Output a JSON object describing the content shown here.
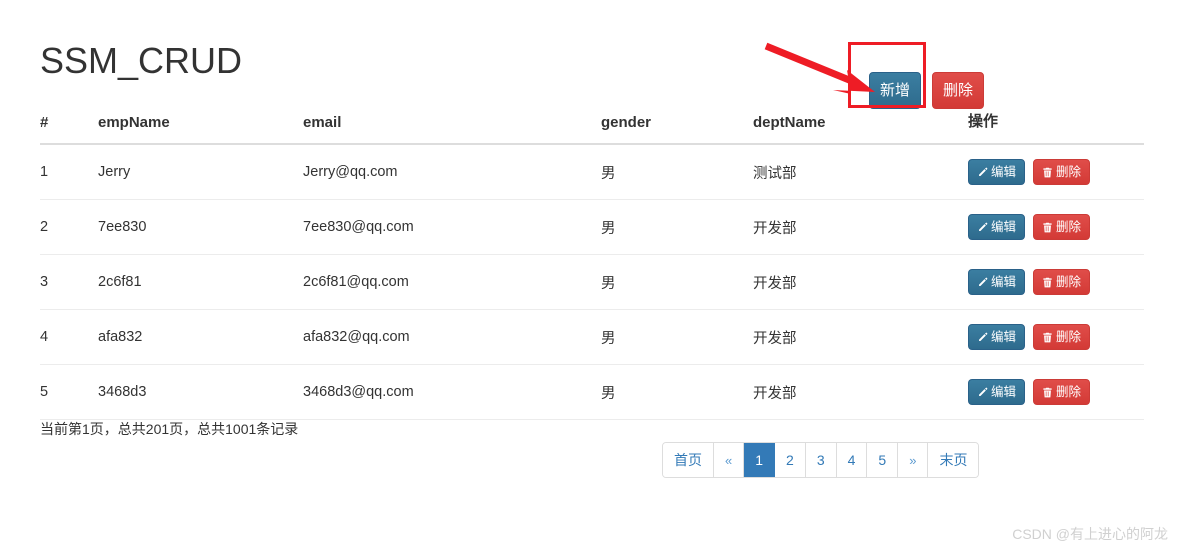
{
  "page": {
    "title": "SSM_CRUD"
  },
  "toolbar": {
    "add_label": "新增",
    "delete_label": "删除",
    "add_icon": "none",
    "delete_icon": "none",
    "primary_color": "#31708f",
    "danger_color": "#d9534f"
  },
  "annotation": {
    "rect_color": "#ee1c25",
    "arrow_color": "#ee1c25",
    "arrow_target": "新增"
  },
  "table": {
    "columns": [
      {
        "key": "idx",
        "label": "#"
      },
      {
        "key": "empName",
        "label": "empName"
      },
      {
        "key": "email",
        "label": "email"
      },
      {
        "key": "gender",
        "label": "gender"
      },
      {
        "key": "deptName",
        "label": "deptName"
      },
      {
        "key": "ops",
        "label": "操作"
      }
    ],
    "row_actions": {
      "edit_label": "编辑",
      "edit_icon": "pencil-icon",
      "delete_label": "删除",
      "delete_icon": "trash-icon"
    },
    "rows": [
      {
        "idx": "1",
        "empName": "Jerry",
        "email": "Jerry@qq.com",
        "gender": "男",
        "deptName": "测试部"
      },
      {
        "idx": "2",
        "empName": "7ee830",
        "email": "7ee830@qq.com",
        "gender": "男",
        "deptName": "开发部"
      },
      {
        "idx": "3",
        "empName": "2c6f81",
        "email": "2c6f81@qq.com",
        "gender": "男",
        "deptName": "开发部"
      },
      {
        "idx": "4",
        "empName": "afa832",
        "email": "afa832@qq.com",
        "gender": "男",
        "deptName": "开发部"
      },
      {
        "idx": "5",
        "empName": "3468d3",
        "email": "3468d3@qq.com",
        "gender": "男",
        "deptName": "开发部"
      }
    ]
  },
  "footer": {
    "page_info": "当前第1页，总共201页，总共1001条记录"
  },
  "pagination": {
    "items": [
      {
        "label": "首页",
        "type": "first",
        "active": false
      },
      {
        "label": "«",
        "type": "prev",
        "active": false
      },
      {
        "label": "1",
        "type": "page",
        "active": true
      },
      {
        "label": "2",
        "type": "page",
        "active": false
      },
      {
        "label": "3",
        "type": "page",
        "active": false
      },
      {
        "label": "4",
        "type": "page",
        "active": false
      },
      {
        "label": "5",
        "type": "page",
        "active": false
      },
      {
        "label": "»",
        "type": "next",
        "active": false
      },
      {
        "label": "末页",
        "type": "last",
        "active": false
      }
    ],
    "active_color": "#337ab7"
  },
  "watermark": {
    "text": "CSDN @有上进心的阿龙"
  }
}
